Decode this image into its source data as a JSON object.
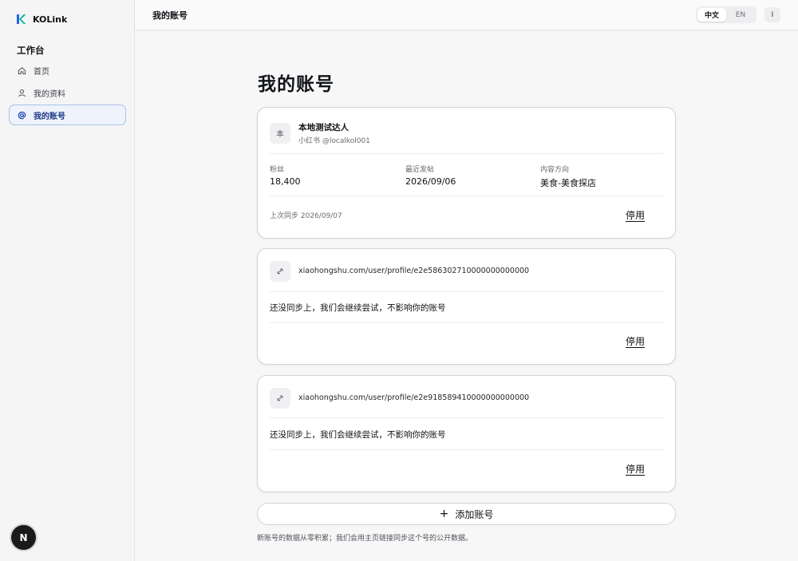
{
  "app": {
    "name": "KOLink",
    "brand_color": "#2563eb"
  },
  "sidebar": {
    "section_title": "工作台",
    "items": [
      {
        "label": "首页",
        "icon": "home-icon"
      },
      {
        "label": "我的资料",
        "icon": "user-icon"
      },
      {
        "label": "我的账号",
        "icon": "at-icon",
        "active": true
      }
    ],
    "user_avatar": "N"
  },
  "header": {
    "title": "我的账号",
    "lang_zh": "中文",
    "lang_en": "EN",
    "menu_label": "I"
  },
  "main": {
    "title": "我的账号",
    "accounts": [
      {
        "avatar_text": "本",
        "name": "本地测试达人",
        "handle": "小红书 @localkol001",
        "stats": [
          {
            "label": "粉丝",
            "value": "18,400"
          },
          {
            "label": "最近发帖",
            "value": "2026/09/06"
          },
          {
            "label": "内容方向",
            "value": "美食-美食探店"
          }
        ],
        "sync": "上次同步 2026/09/07",
        "action": "停用"
      },
      {
        "url": "xiaohongshu.com/user/profile/e2e586302710000000000000",
        "message": "还没同步上，我们会继续尝试，不影响你的账号",
        "action": "停用"
      },
      {
        "url": "xiaohongshu.com/user/profile/e2e918589410000000000000",
        "message": "还没同步上，我们会继续尝试，不影响你的账号",
        "action": "停用"
      }
    ],
    "add_button": "添加账号",
    "footnote": "新账号的数据从零积累；我们会用主页链接同步这个号的公开数据。"
  }
}
